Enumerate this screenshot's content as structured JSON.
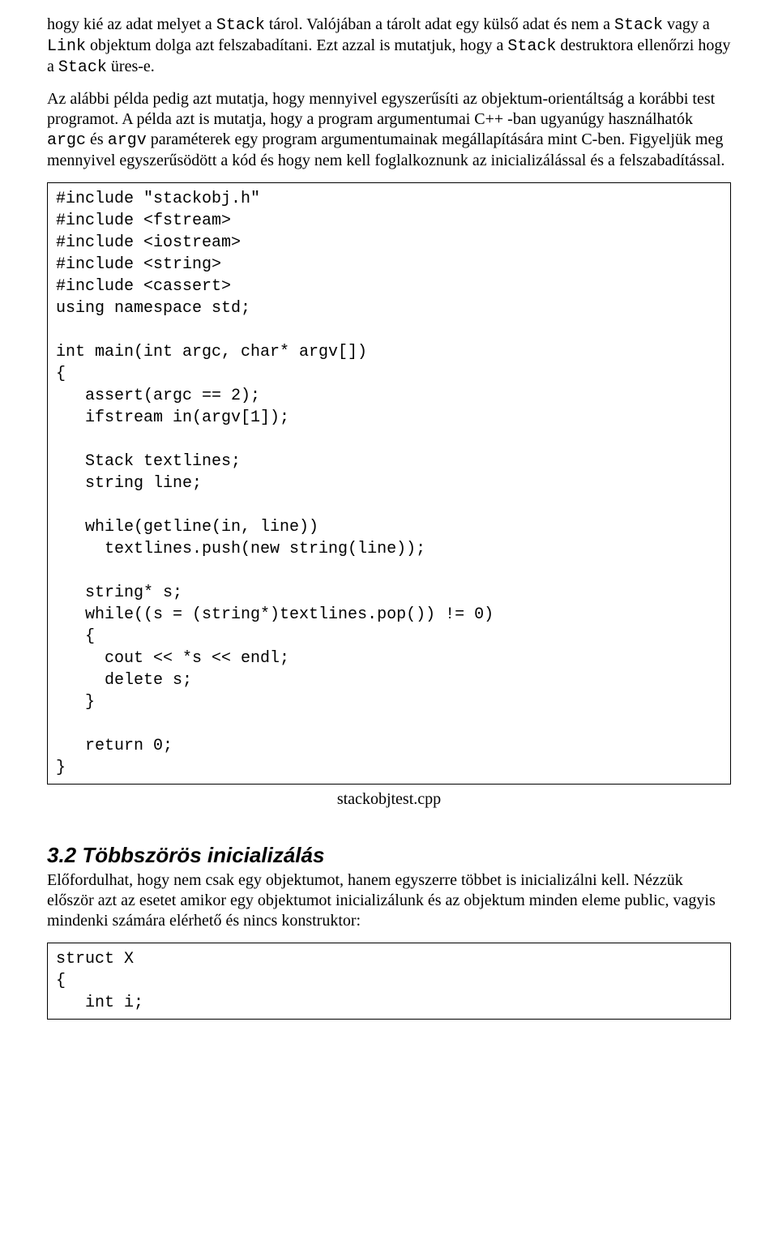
{
  "para1": {
    "seg1": "hogy kié az adat melyet a ",
    "code1": "Stack",
    "seg2": " tárol. Valójában a tárolt adat egy külső adat és nem a ",
    "code2": "Stack",
    "seg3": " vagy a ",
    "code3": "Link",
    "seg4": " objektum dolga azt felszabadítani. Ezt azzal is mutatjuk, hogy a ",
    "code4": "Stack",
    "seg5": " destruktora ellenőrzi hogy a ",
    "code5": "Stack",
    "seg6": " üres-e."
  },
  "para2": {
    "seg1": "Az alábbi példa pedig azt mutatja, hogy mennyivel egyszerűsíti az objektum-orientáltság a korábbi test programot. A példa azt is mutatja, hogy a program argumentumai C++ -ban ugyanúgy használhatók ",
    "code1": "argc",
    "seg2": " és ",
    "code2": "argv",
    "seg3": " paraméterek egy program argumentumainak megállapítására mint C-ben. Figyeljük meg mennyivel egyszerűsödött a kód és hogy nem kell foglalkoznunk az inicializálással és a felszabadítással."
  },
  "code1": "#include \"stackobj.h\"\n#include <fstream>\n#include <iostream>\n#include <string>\n#include <cassert>\nusing namespace std;\n\nint main(int argc, char* argv[])\n{\n   assert(argc == 2);\n   ifstream in(argv[1]);\n\n   Stack textlines;\n   string line;\n\n   while(getline(in, line))\n     textlines.push(new string(line));\n\n   string* s;\n   while((s = (string*)textlines.pop()) != 0)\n   {\n     cout << *s << endl;\n     delete s;\n   }\n\n   return 0;\n}",
  "caption1": "stackobjtest.cpp",
  "heading": "3.2 Többszörös inicializálás",
  "para3": "Előfordulhat, hogy nem csak egy objektumot, hanem egyszerre többet is inicializálni kell. Nézzük először azt az esetet amikor egy objektumot inicializálunk és az objektum minden eleme public, vagyis mindenki számára elérhető és nincs konstruktor:",
  "code2": "struct X\n{\n   int i;"
}
